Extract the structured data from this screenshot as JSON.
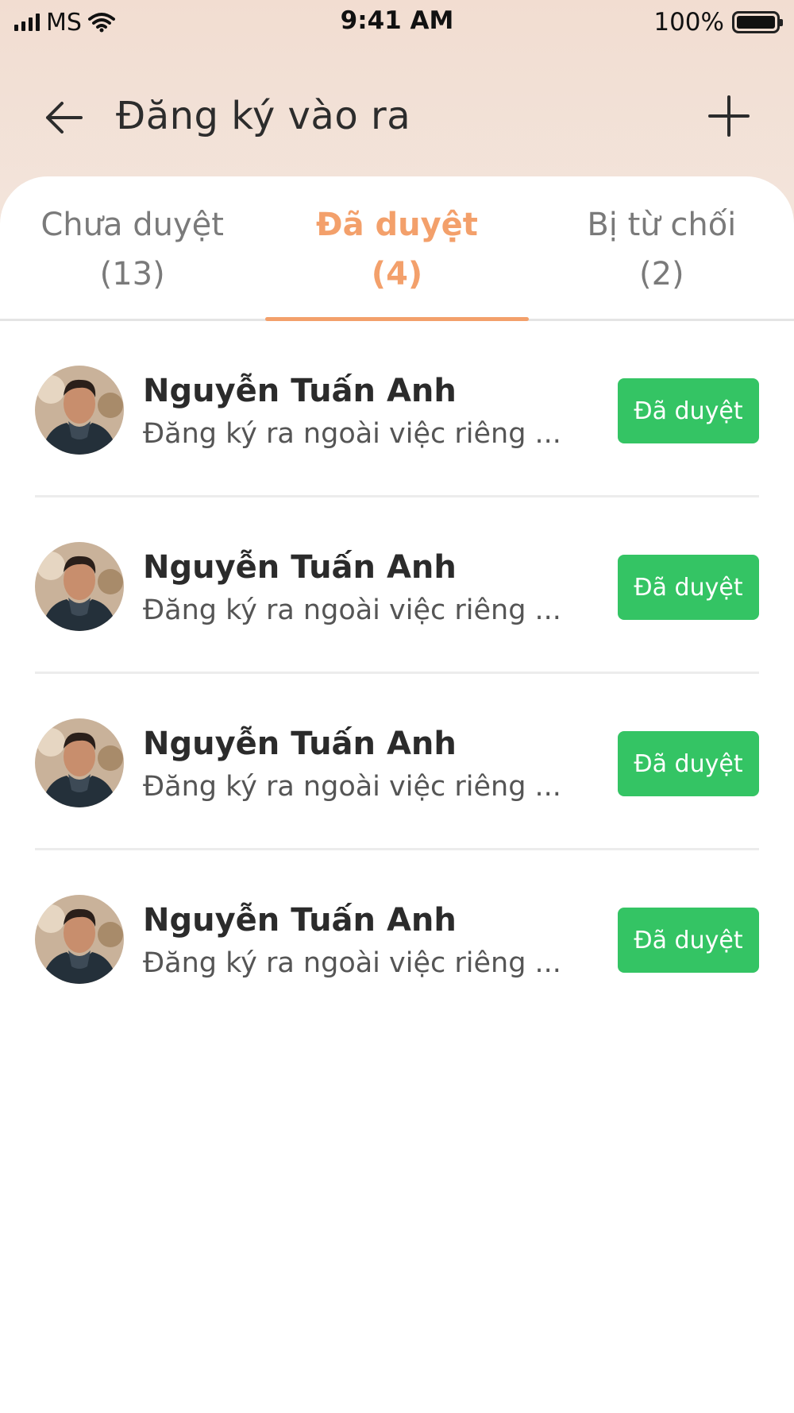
{
  "status_bar": {
    "carrier": "MS",
    "time": "9:41 AM",
    "battery_text": "100%"
  },
  "header": {
    "title": "Đăng ký vào ra",
    "back_icon": "arrow-left-icon",
    "add_icon": "plus-icon"
  },
  "tabs": [
    {
      "label": "Chưa duyệt",
      "count": "(13)"
    },
    {
      "label": "Đã duyệt",
      "count": "(4)"
    },
    {
      "label": "Bị từ chối",
      "count": "(2)"
    }
  ],
  "active_tab": "Đã duyệt",
  "colors": {
    "accent": "#f3a06b",
    "approved": "#34c464",
    "header_bg": "#f2ddd1"
  },
  "items": [
    {
      "name": "Nguyễn Tuấn Anh",
      "description": "Đăng ký ra ngoài việc riêng ...",
      "status": "Đã duyệt"
    },
    {
      "name": "Nguyễn Tuấn Anh",
      "description": "Đăng ký ra ngoài việc riêng ...",
      "status": "Đã duyệt"
    },
    {
      "name": "Nguyễn Tuấn Anh",
      "description": "Đăng ký ra ngoài việc riêng ...",
      "status": "Đã duyệt"
    },
    {
      "name": "Nguyễn Tuấn Anh",
      "description": "Đăng ký ra ngoài việc riêng ...",
      "status": "Đã duyệt"
    }
  ]
}
